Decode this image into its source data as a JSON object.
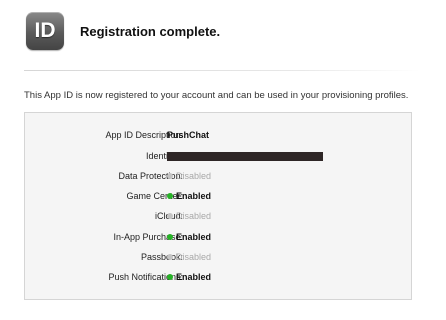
{
  "header": {
    "icon_text": "ID",
    "icon_name": "app-id-icon",
    "title": "Registration complete."
  },
  "message": "This App ID is now registered to your account and can be used in your provisioning profiles.",
  "details": {
    "description_label": "App ID Description:",
    "description_value": "PushChat",
    "identifier_label": "Identifier:",
    "identifier_value_redacted": true
  },
  "services": [
    {
      "label": "Data Protection:",
      "status": "Disabled"
    },
    {
      "label": "Game Center:",
      "status": "Enabled"
    },
    {
      "label": "iCloud:",
      "status": "Disabled"
    },
    {
      "label": "In-App Purchase:",
      "status": "Enabled"
    },
    {
      "label": "Passbook:",
      "status": "Disabled"
    },
    {
      "label": "Push Notifications:",
      "status": "Enabled"
    }
  ],
  "colors": {
    "enabled_dot": "#27b227",
    "disabled_dot": "#c4c4c4",
    "redaction_bar": "#2e2626"
  }
}
